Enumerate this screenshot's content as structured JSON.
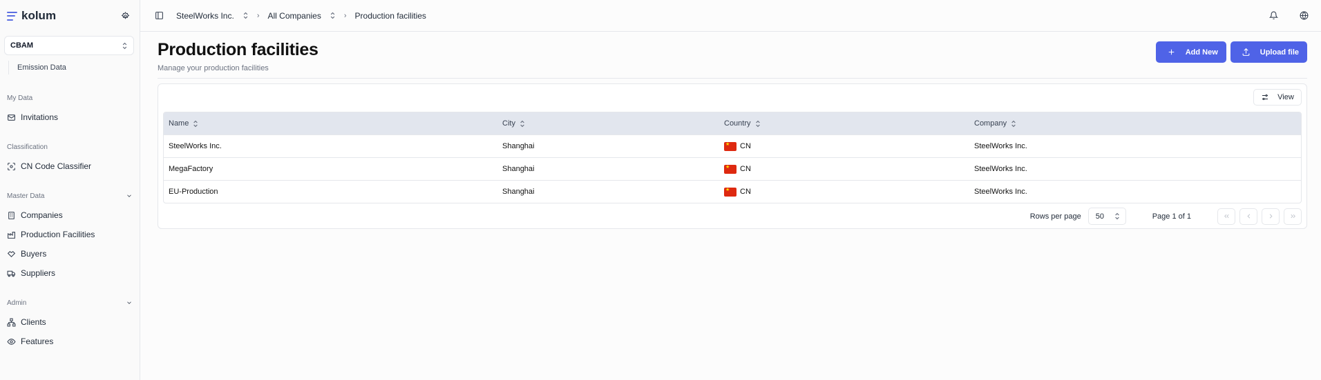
{
  "app": {
    "name": "kolum"
  },
  "sidebar": {
    "module_select": "CBAM",
    "module_sub": "Emission Data",
    "sections": [
      {
        "label": "My Data",
        "items": [
          {
            "label": "Invitations",
            "icon": "mail-icon"
          }
        ]
      },
      {
        "label": "Classification",
        "items": [
          {
            "label": "CN Code Classifier",
            "icon": "scan-icon"
          }
        ]
      },
      {
        "label": "Master Data",
        "items": [
          {
            "label": "Companies",
            "icon": "building-icon"
          },
          {
            "label": "Production Facilities",
            "icon": "factory-icon"
          },
          {
            "label": "Buyers",
            "icon": "handshake-icon"
          },
          {
            "label": "Suppliers",
            "icon": "truck-icon"
          }
        ]
      },
      {
        "label": "Admin",
        "items": [
          {
            "label": "Clients",
            "icon": "network-icon"
          },
          {
            "label": "Features",
            "icon": "eye-icon"
          }
        ]
      }
    ]
  },
  "breadcrumb": {
    "company": "SteelWorks Inc.",
    "scope": "All Companies",
    "current": "Production facilities"
  },
  "page": {
    "title": "Production facilities",
    "subtitle": "Manage your production facilities"
  },
  "actions": {
    "add_label": "Add New",
    "upload_label": "Upload file"
  },
  "table": {
    "view_label": "View",
    "columns": [
      "Name",
      "City",
      "Country",
      "Company"
    ],
    "rows": [
      {
        "name": "SteelWorks Inc.",
        "city": "Shanghai",
        "country": "CN",
        "company": "SteelWorks Inc."
      },
      {
        "name": "MegaFactory",
        "city": "Shanghai",
        "country": "CN",
        "company": "SteelWorks Inc."
      },
      {
        "name": "EU-Production",
        "city": "Shanghai",
        "country": "CN",
        "company": "SteelWorks Inc."
      }
    ]
  },
  "pagination": {
    "rows_per_page_label": "Rows per page",
    "rows_per_page": "50",
    "page_info": "Page 1 of 1"
  },
  "colors": {
    "primary": "#4f63e7",
    "header_bg": "#e2e6ee",
    "flag_red": "#de2910"
  }
}
